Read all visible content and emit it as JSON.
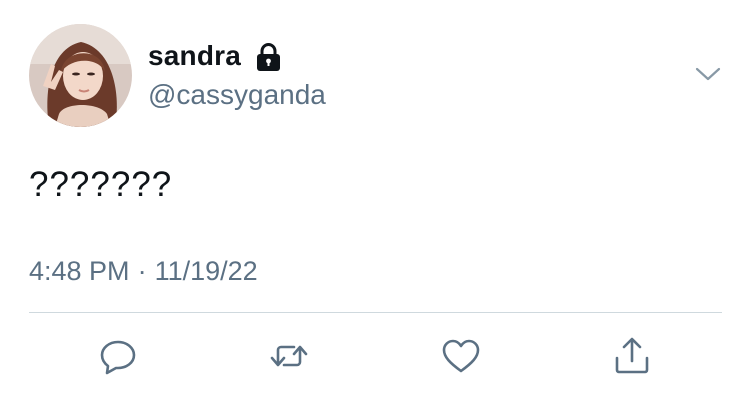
{
  "tweet": {
    "display_name": "sandra",
    "handle": "@cassyganda",
    "text": "???????",
    "time": "4:48 PM",
    "separator": "·",
    "date": "11/19/22"
  },
  "icons": {
    "account": "lock-icon",
    "menu": "chevron-down-icon",
    "actions": [
      "reply-icon",
      "retweet-icon",
      "like-icon",
      "share-icon"
    ]
  },
  "colors": {
    "primary_text": "#0f1419",
    "secondary_text": "#5b7083",
    "divider": "#cfd9de",
    "background": "#ffffff"
  }
}
